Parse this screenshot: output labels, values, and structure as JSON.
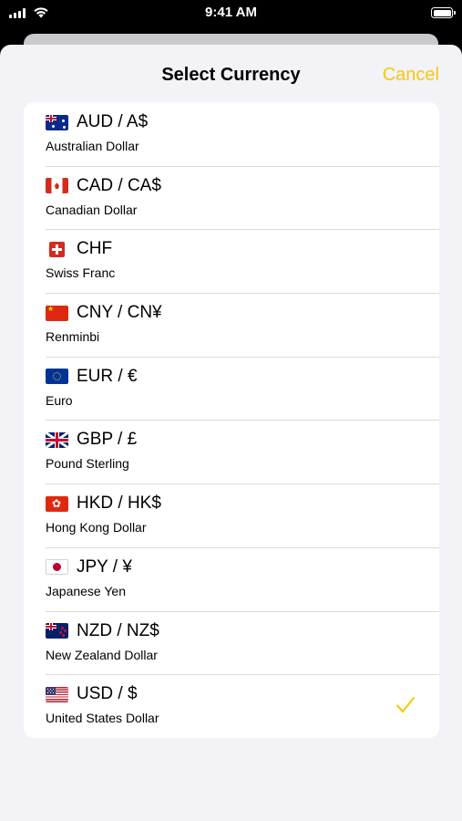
{
  "status_bar": {
    "time": "9:41 AM"
  },
  "header": {
    "title": "Select Currency",
    "cancel_label": "Cancel"
  },
  "colors": {
    "accent": "#f6c90e",
    "sheet_background": "#f2f2f7",
    "list_background": "#ffffff"
  },
  "currencies": [
    {
      "code": "AUD / A$",
      "name": "Australian Dollar",
      "flag": "australia-flag-icon",
      "selected": false
    },
    {
      "code": "CAD / CA$",
      "name": "Canadian Dollar",
      "flag": "canada-flag-icon",
      "selected": false
    },
    {
      "code": "CHF",
      "name": "Swiss Franc",
      "flag": "switzerland-flag-icon",
      "selected": false
    },
    {
      "code": "CNY / CN¥",
      "name": "Renminbi",
      "flag": "china-flag-icon",
      "selected": false
    },
    {
      "code": "EUR / €",
      "name": "Euro",
      "flag": "eu-flag-icon",
      "selected": false
    },
    {
      "code": "GBP / £",
      "name": "Pound Sterling",
      "flag": "uk-flag-icon",
      "selected": false
    },
    {
      "code": "HKD / HK$",
      "name": "Hong Kong Dollar",
      "flag": "hong-kong-flag-icon",
      "selected": false
    },
    {
      "code": "JPY / ¥",
      "name": "Japanese Yen",
      "flag": "japan-flag-icon",
      "selected": false
    },
    {
      "code": "NZD / NZ$",
      "name": "New Zealand Dollar",
      "flag": "new-zealand-flag-icon",
      "selected": false
    },
    {
      "code": "USD / $",
      "name": "United States Dollar",
      "flag": "usa-flag-icon",
      "selected": true
    }
  ]
}
